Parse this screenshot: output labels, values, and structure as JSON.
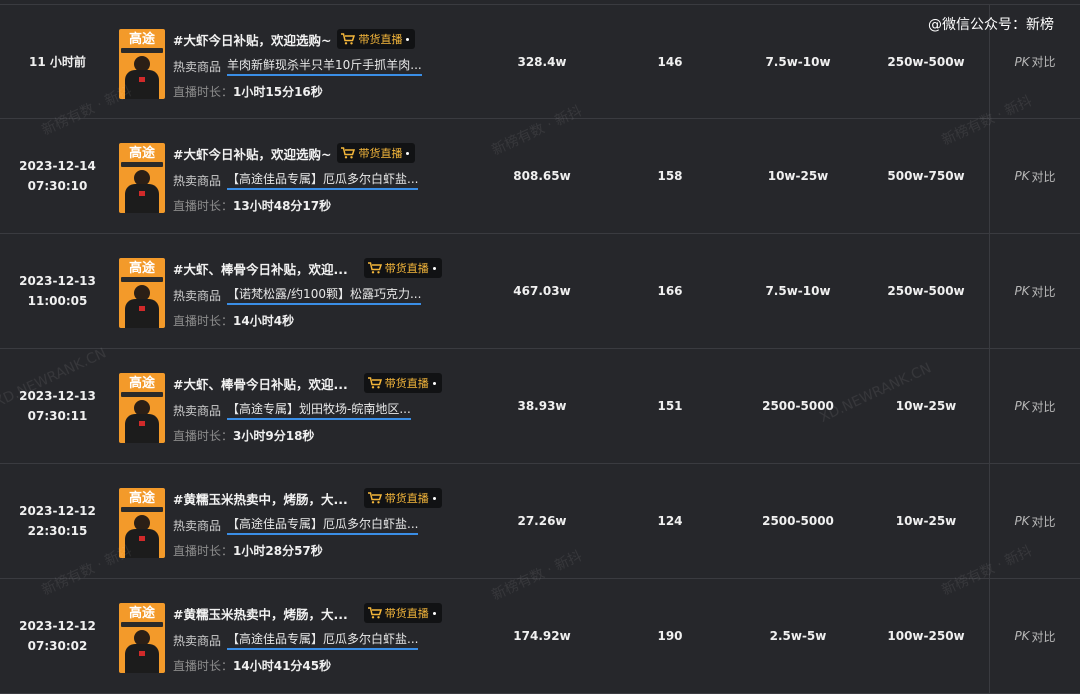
{
  "watermark": {
    "top_right": "@微信公众号：新榜",
    "faint": [
      "新榜有数 · 新抖",
      "XD.NEWRANK.CN"
    ]
  },
  "columns": [],
  "badge_label": "带货直播",
  "product_label": "热卖商品",
  "duration_label": "直播时长：",
  "pk_label": "对比",
  "pk_icon_text": "PK",
  "rows": [
    {
      "time_line1": "11 小时前",
      "time_line2": "",
      "title": "#大虾今日补贴，欢迎选购~",
      "product": "羊肉新鲜现杀半只羊10斤手抓羊肉...",
      "duration": "1小时15分16秒",
      "views": "328.4w",
      "products": "146",
      "sales": "7.5w-10w",
      "gmv": "250w-500w"
    },
    {
      "time_line1": "2023-12-14",
      "time_line2": "07:30:10",
      "title": "#大虾今日补贴，欢迎选购~",
      "product": "【高途佳品专属】厄瓜多尔白虾盐...",
      "duration": "13小时48分17秒",
      "views": "808.65w",
      "products": "158",
      "sales": "10w-25w",
      "gmv": "500w-750w"
    },
    {
      "time_line1": "2023-12-13",
      "time_line2": "11:00:05",
      "title": "#大虾、棒骨今日补贴，欢迎...",
      "product": "【诺梵松露/约100颗】松露巧克力...",
      "duration": "14小时4秒",
      "views": "467.03w",
      "products": "166",
      "sales": "7.5w-10w",
      "gmv": "250w-500w"
    },
    {
      "time_line1": "2023-12-13",
      "time_line2": "07:30:11",
      "title": "#大虾、棒骨今日补贴，欢迎...",
      "product": "【高途专属】划田牧场-皖南地区...",
      "duration": "3小时9分18秒",
      "views": "38.93w",
      "products": "151",
      "sales": "2500-5000",
      "gmv": "10w-25w"
    },
    {
      "time_line1": "2023-12-12",
      "time_line2": "22:30:15",
      "title": "#黄糯玉米热卖中，烤肠，大...",
      "product": "【高途佳品专属】厄瓜多尔白虾盐...",
      "duration": "1小时28分57秒",
      "views": "27.26w",
      "products": "124",
      "sales": "2500-5000",
      "gmv": "10w-25w"
    },
    {
      "time_line1": "2023-12-12",
      "time_line2": "07:30:02",
      "title": "#黄糯玉米热卖中，烤肠，大...",
      "product": "【高途佳品专属】厄瓜多尔白虾盐...",
      "duration": "14小时41分45秒",
      "views": "174.92w",
      "products": "190",
      "sales": "2.5w-5w",
      "gmv": "100w-250w"
    }
  ],
  "cover": {
    "title": "高途",
    "bg_color": "#f39a2a"
  },
  "colors": {
    "background": "#26272b",
    "badge_text": "#f5b73b",
    "link_underline": "#3a8ee6"
  }
}
